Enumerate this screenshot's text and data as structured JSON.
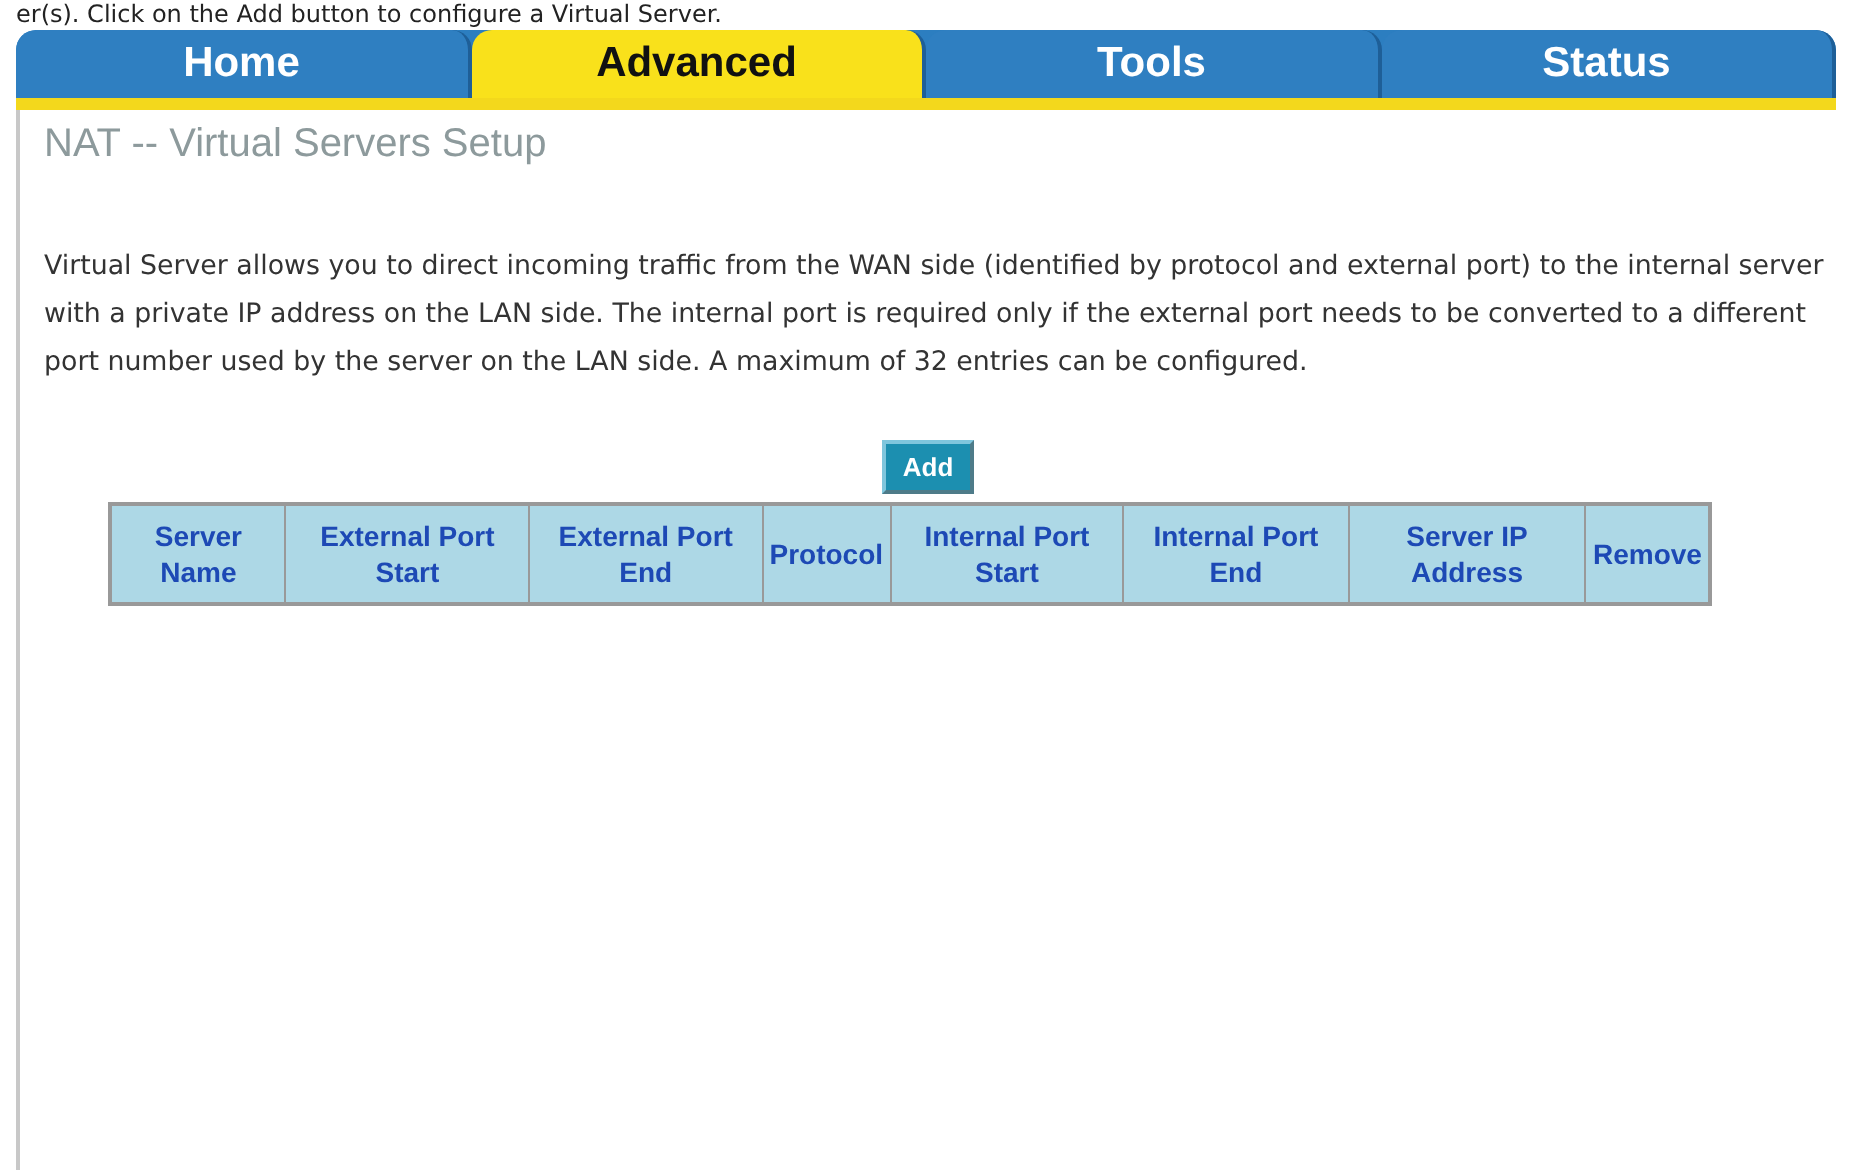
{
  "caption": "er(s).  Click on the Add button to configure a Virtual Server.",
  "tabs": [
    {
      "label": "Home",
      "selected": false
    },
    {
      "label": "Advanced",
      "selected": true
    },
    {
      "label": "Tools",
      "selected": false
    },
    {
      "label": "Status",
      "selected": false
    }
  ],
  "page_title": "NAT -- Virtual Servers Setup",
  "description": "Virtual Server allows you to direct incoming traffic from the WAN side (identified by protocol and external port) to the internal server with a private IP address on the LAN side. The internal port is required only if the external port needs to be converted to a different port number used by the server on the LAN side. A maximum of 32 entries can be configured.",
  "add_button": "Add",
  "table": {
    "columns": [
      "Server Name",
      "External Port Start",
      "External Port End",
      "Protocol",
      "Internal Port Start",
      "Internal Port End",
      "Server IP Address",
      "Remove"
    ]
  }
}
